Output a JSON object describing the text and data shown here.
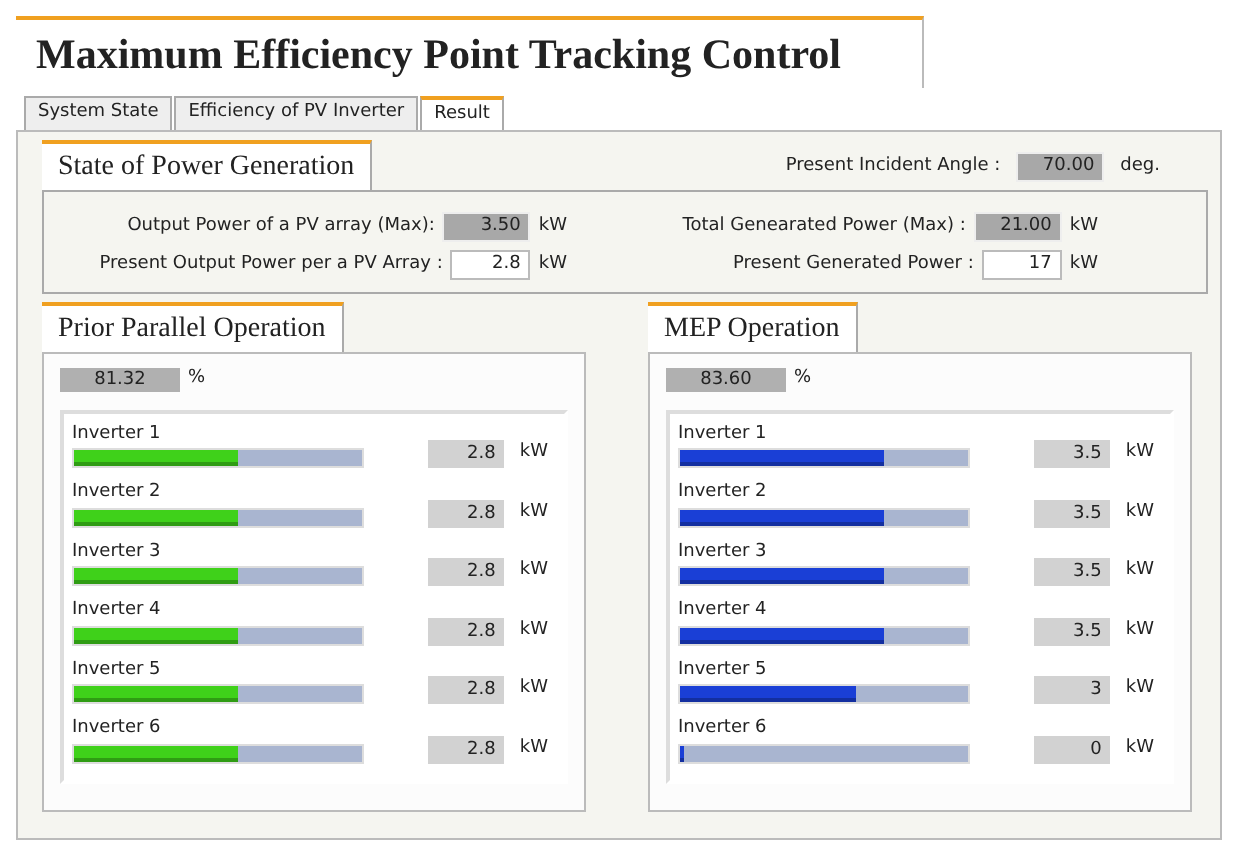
{
  "title": "Maximum Efficiency Point Tracking Control",
  "tabs": [
    {
      "label": "System State",
      "selected": false
    },
    {
      "label": "Efficiency of PV Inverter",
      "selected": false
    },
    {
      "label": "Result",
      "selected": true
    }
  ],
  "power_generation": {
    "title": "State of Power Generation",
    "incident_angle": {
      "label": "Present Incident Angle :",
      "value": "70.00",
      "unit": "deg.",
      "kind": "readonly"
    },
    "fields": [
      {
        "label": "Output Power of a PV array (Max):",
        "value": "3.50",
        "unit": "kW",
        "kind": "readonly"
      },
      {
        "label": "Total Genearated Power (Max) :",
        "value": "21.00",
        "unit": "kW",
        "kind": "readonly"
      },
      {
        "label": "Present Output Power per a PV Array :",
        "value": "2.8",
        "unit": "kW",
        "kind": "input"
      },
      {
        "label": "Present Generated Power :",
        "value": "17",
        "unit": "kW",
        "kind": "input"
      }
    ]
  },
  "operations": [
    {
      "title": "Prior Parallel Operation",
      "efficiency": "81.32",
      "efficiency_unit": "%",
      "color": "#3fd11a",
      "inverters": [
        {
          "name": "Inverter 1",
          "level": 0.57,
          "value": "2.8",
          "unit": "kW"
        },
        {
          "name": "Inverter 2",
          "level": 0.57,
          "value": "2.8",
          "unit": "kW"
        },
        {
          "name": "Inverter 3",
          "level": 0.57,
          "value": "2.8",
          "unit": "kW"
        },
        {
          "name": "Inverter 4",
          "level": 0.57,
          "value": "2.8",
          "unit": "kW"
        },
        {
          "name": "Inverter 5",
          "level": 0.57,
          "value": "2.8",
          "unit": "kW"
        },
        {
          "name": "Inverter 6",
          "level": 0.57,
          "value": "2.8",
          "unit": "kW"
        }
      ]
    },
    {
      "title": "MEP Operation",
      "efficiency": "83.60",
      "efficiency_unit": "%",
      "color": "#1a3fd6",
      "inverters": [
        {
          "name": "Inverter 1",
          "level": 0.71,
          "value": "3.5",
          "unit": "kW"
        },
        {
          "name": "Inverter 2",
          "level": 0.71,
          "value": "3.5",
          "unit": "kW"
        },
        {
          "name": "Inverter 3",
          "level": 0.71,
          "value": "3.5",
          "unit": "kW"
        },
        {
          "name": "Inverter 4",
          "level": 0.71,
          "value": "3.5",
          "unit": "kW"
        },
        {
          "name": "Inverter 5",
          "level": 0.61,
          "value": "3",
          "unit": "kW"
        },
        {
          "name": "Inverter 6",
          "level": 0.015,
          "value": "0",
          "unit": "kW"
        }
      ]
    }
  ]
}
